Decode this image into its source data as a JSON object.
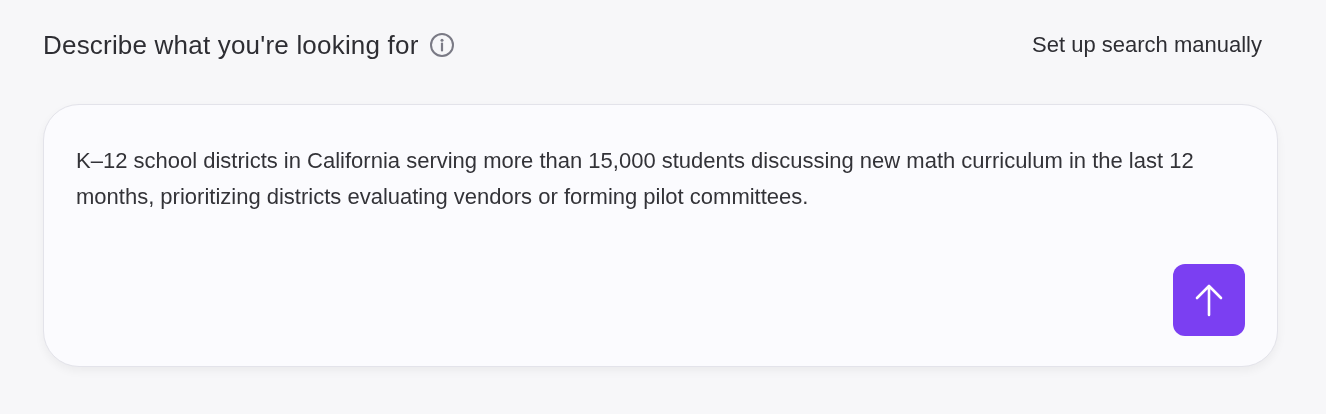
{
  "header": {
    "title": "Describe what you're looking for",
    "info_icon": true,
    "link": "Set up search manually"
  },
  "prompt": {
    "value": "K–12 school districts in California serving more than 15,000 students discussing new math curriculum in the last 12 months, prioritizing districts evaluating vendors or forming pilot committees."
  }
}
